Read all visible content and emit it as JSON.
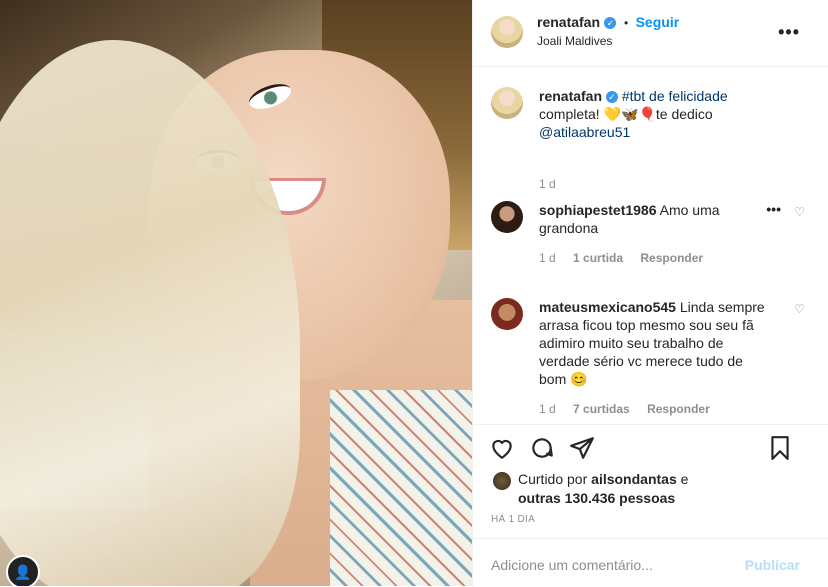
{
  "post": {
    "author": "renatafan",
    "location": "Joali Maldives",
    "follow_label": "Seguir",
    "separator": "•",
    "verified_icon": "verified-badge-icon",
    "caption": {
      "username": "renatafan",
      "text_1": "#tbt de felicidade",
      "text_2": "completa! 💛🦋🎈te dedico",
      "mention": "@atilaabreu51",
      "age": "1 d"
    }
  },
  "comments": [
    {
      "username": "sophiapestet1986",
      "text": "Amo uma grandona",
      "age": "1 d",
      "likes": "1 curtida",
      "reply": "Responder"
    },
    {
      "username": "mateusmexicano545",
      "text": "Linda sempre arrasa ficou top mesmo sou seu fã adimiro muito seu trabalho de verdade sério vc merece tudo de bom 😊",
      "age": "1 d",
      "likes": "7 curtidas",
      "reply": "Responder"
    }
  ],
  "likes": {
    "line_1_prefix": "Curtido por",
    "liker": "ailsondantas",
    "line_1_suffix": "e",
    "line_2": "outras 130.436 pessoas"
  },
  "time_ago": "HÁ 1 DIA",
  "add_comment": {
    "placeholder": "Adicione um comentário...",
    "publish": "Publicar"
  },
  "icons": [
    "heart-icon",
    "comment-icon",
    "share-icon",
    "bookmark-icon",
    "more-options-icon"
  ]
}
